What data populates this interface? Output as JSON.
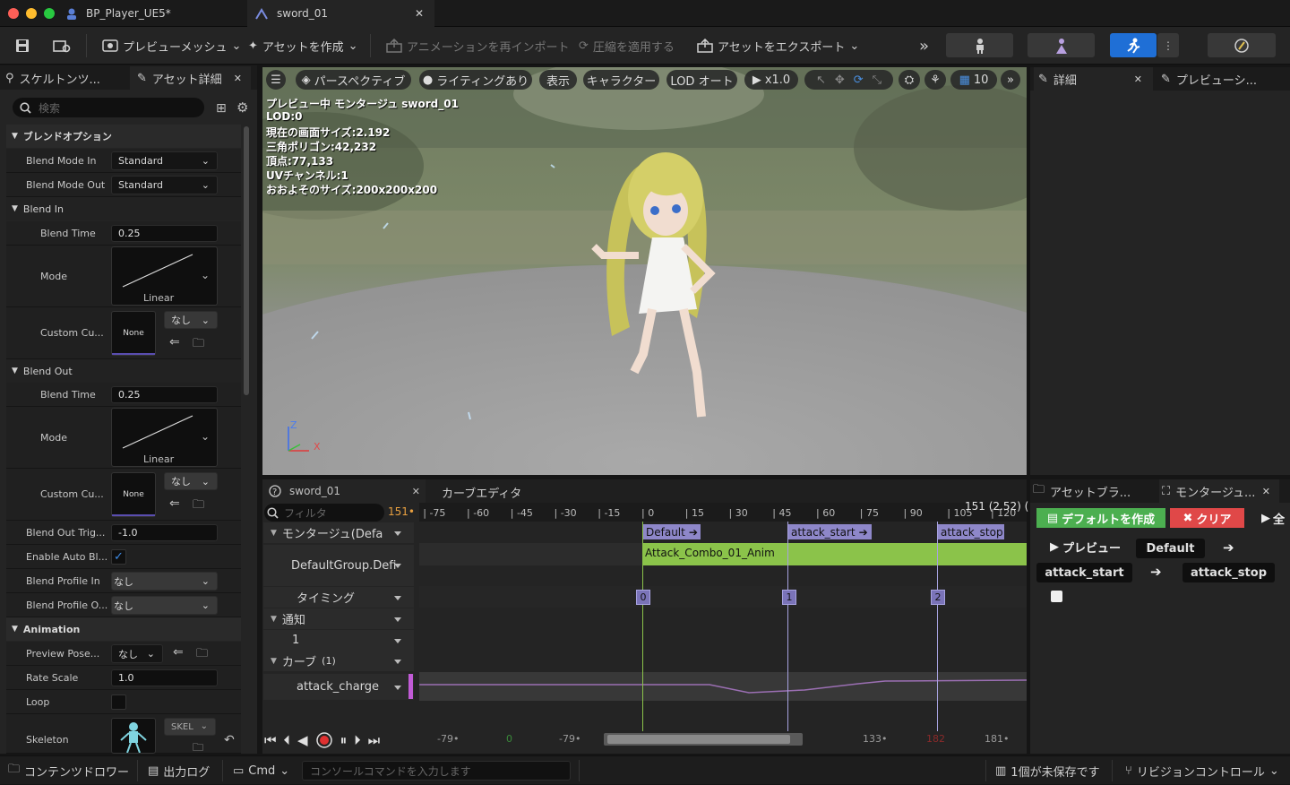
{
  "window": {
    "tabs": [
      {
        "label": "BP_Player_UE5*"
      },
      {
        "label": "sword_01"
      }
    ]
  },
  "toolbar": {
    "preview_mesh": "プレビューメッシュ",
    "create_asset": "アセットを作成",
    "reimport_anim": "アニメーションを再インポート",
    "apply_compression": "圧縮を適用する",
    "export_asset": "アセットをエクスポート"
  },
  "left_panel": {
    "tabs": [
      "スケルトンツ...",
      "アセット詳細"
    ],
    "search_placeholder": "検索",
    "sections": {
      "blend_options": "ブレンドオプション",
      "blend_in": "Blend In",
      "blend_out": "Blend Out",
      "animation": "Animation"
    },
    "props": {
      "blend_mode_in": {
        "label": "Blend Mode In",
        "value": "Standard"
      },
      "blend_mode_out": {
        "label": "Blend Mode Out",
        "value": "Standard"
      },
      "blend_in_time": {
        "label": "Blend Time",
        "value": "0.25"
      },
      "blend_in_mode": {
        "label": "Mode",
        "value": "Linear"
      },
      "blend_in_custom": {
        "label": "Custom Cu...",
        "asset": "None",
        "value": "なし"
      },
      "blend_out_time": {
        "label": "Blend Time",
        "value": "0.25"
      },
      "blend_out_mode": {
        "label": "Mode",
        "value": "Linear"
      },
      "blend_out_custom": {
        "label": "Custom Cu...",
        "asset": "None",
        "value": "なし"
      },
      "blend_out_trigger": {
        "label": "Blend Out Trig...",
        "value": "-1.0"
      },
      "enable_auto_blend": {
        "label": "Enable Auto Bl...",
        "checked": true
      },
      "blend_profile_in": {
        "label": "Blend Profile In",
        "value": "なし"
      },
      "blend_profile_out": {
        "label": "Blend Profile O...",
        "value": "なし"
      },
      "preview_pose": {
        "label": "Preview Pose...",
        "value": "なし"
      },
      "rate_scale": {
        "label": "Rate Scale",
        "value": "1.0"
      },
      "loop": {
        "label": "Loop",
        "checked": false
      },
      "skeleton": {
        "label": "Skeleton",
        "value": "SKEL"
      }
    }
  },
  "viewport": {
    "perspective": "パースペクティブ",
    "lighting": "ライティングあり",
    "show": "表示",
    "character": "キャラクター",
    "lod": "LOD オート",
    "play_rate": "x1.0",
    "grid_value": "10",
    "stats": [
      "プレビュー中 モンタージュ sword_01",
      "LOD:0",
      "現在の画面サイズ:2.192",
      "三角ポリゴン:42,232",
      "頂点:77,133",
      "UVチャンネル:1",
      "おおよそのサイズ:200x200x200"
    ],
    "axis": {
      "z": "Z",
      "x": "X"
    }
  },
  "right_panel": {
    "tabs": [
      "詳細",
      "プレビューシ..."
    ]
  },
  "montage_editor": {
    "tab": "sword_01",
    "curve_tab": "カーブエディタ",
    "filter_placeholder": "フィルタ",
    "frame_indicator": "151",
    "frame_info": "151 (2.52) (",
    "tracks": {
      "montage": "モンタージュ(Defa",
      "default_group": "DefaultGroup.Defi",
      "timing": "タイミング",
      "notify": "通知",
      "notify_track": "1",
      "curves": "カーブ",
      "curves_count": "(1)",
      "attack_charge": "attack_charge"
    },
    "ticks": [
      "-75",
      "-60",
      "-45",
      "-30",
      "-15",
      "0",
      "15",
      "30",
      "45",
      "60",
      "75",
      "90",
      "105",
      "120"
    ],
    "sections": [
      "Default",
      "attack_start",
      "attack_stop"
    ],
    "anim_segment": "Attack_Combo_01_Anim",
    "timing_markers": [
      "0",
      "1",
      "2"
    ],
    "footer": {
      "a": "-79",
      "b": "0",
      "c": "-79",
      "d": "133",
      "e": "182",
      "f": "181"
    },
    "colors": {
      "segment": "#8bc34a",
      "section": "#8e87c9",
      "curve": "#9b6fb3"
    }
  },
  "montage_sections": {
    "tabs": [
      "アセットブラ...",
      "モンタージュ..."
    ],
    "create_default": "デフォルトを作成",
    "clear": "クリア",
    "all": "全",
    "preview": "プレビュー",
    "sections": [
      "Default",
      "attack_start",
      "attack_stop"
    ]
  },
  "statusbar": {
    "content_drawer": "コンテンツドロワー",
    "output_log": "出力ログ",
    "cmd": "Cmd",
    "console_placeholder": "コンソールコマンドを入力します",
    "unsaved": "1個が未保存です",
    "revision_control": "リビジョンコントロール"
  }
}
